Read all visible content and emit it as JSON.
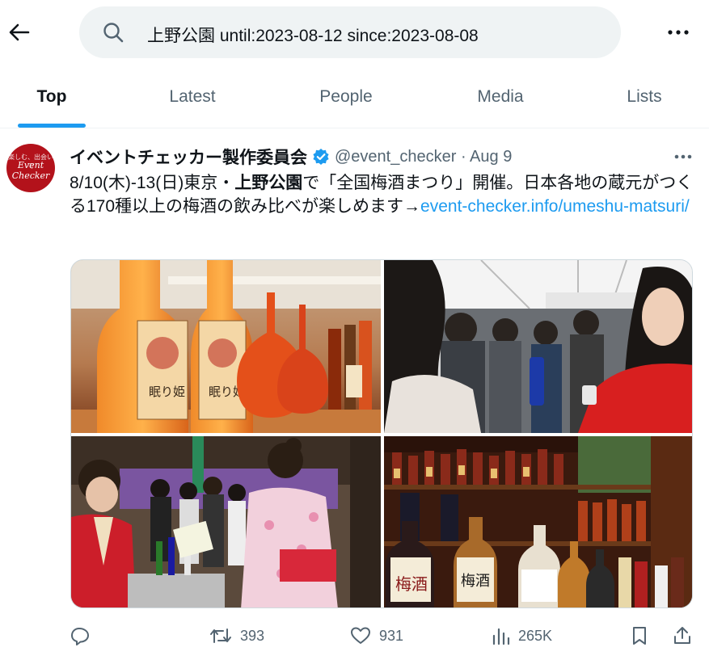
{
  "search": {
    "query": "上野公園 until:2023-08-12 since:2023-08-08"
  },
  "tabs": [
    {
      "label": "Top",
      "active": true
    },
    {
      "label": "Latest",
      "active": false
    },
    {
      "label": "People",
      "active": false
    },
    {
      "label": "Media",
      "active": false
    },
    {
      "label": "Lists",
      "active": false
    }
  ],
  "tweet": {
    "avatar": {
      "line1": "楽しむ、出会いで",
      "line2": "Event",
      "line3": "Checker"
    },
    "author_name": "イベントチェッカー製作委員会",
    "handle_date": "@event_checker · Aug 9",
    "text": {
      "part1": "8/10(木)-13(日)東京・",
      "bold": "上野公園",
      "part2": "で「全国梅酒まつり」開催。日本各地の蔵元がつくる170種以上の梅酒の飲み比べが楽しめます→",
      "link": "event-checker.info/umeshu-matsuri/"
    },
    "media": [
      {
        "label_left": "眠り姫",
        "label_right": "眠り姫"
      },
      {
        "label": ""
      },
      {
        "label": ""
      },
      {
        "label_a": "梅酒",
        "label_b": "梅酒"
      }
    ],
    "stats": {
      "reply": "",
      "retweets": "393",
      "likes": "931",
      "views": "265K"
    }
  },
  "colors": {
    "accent": "#1d9bf0",
    "text_primary": "#0f1419",
    "text_secondary": "#536471",
    "search_bg": "#eff3f4",
    "avatar_bg": "#b3121b"
  },
  "icons": [
    "back-arrow-icon",
    "search-icon",
    "more-icon",
    "verified-badge-icon",
    "reply-icon",
    "retweet-icon",
    "like-icon",
    "views-icon",
    "bookmark-icon",
    "share-icon"
  ]
}
